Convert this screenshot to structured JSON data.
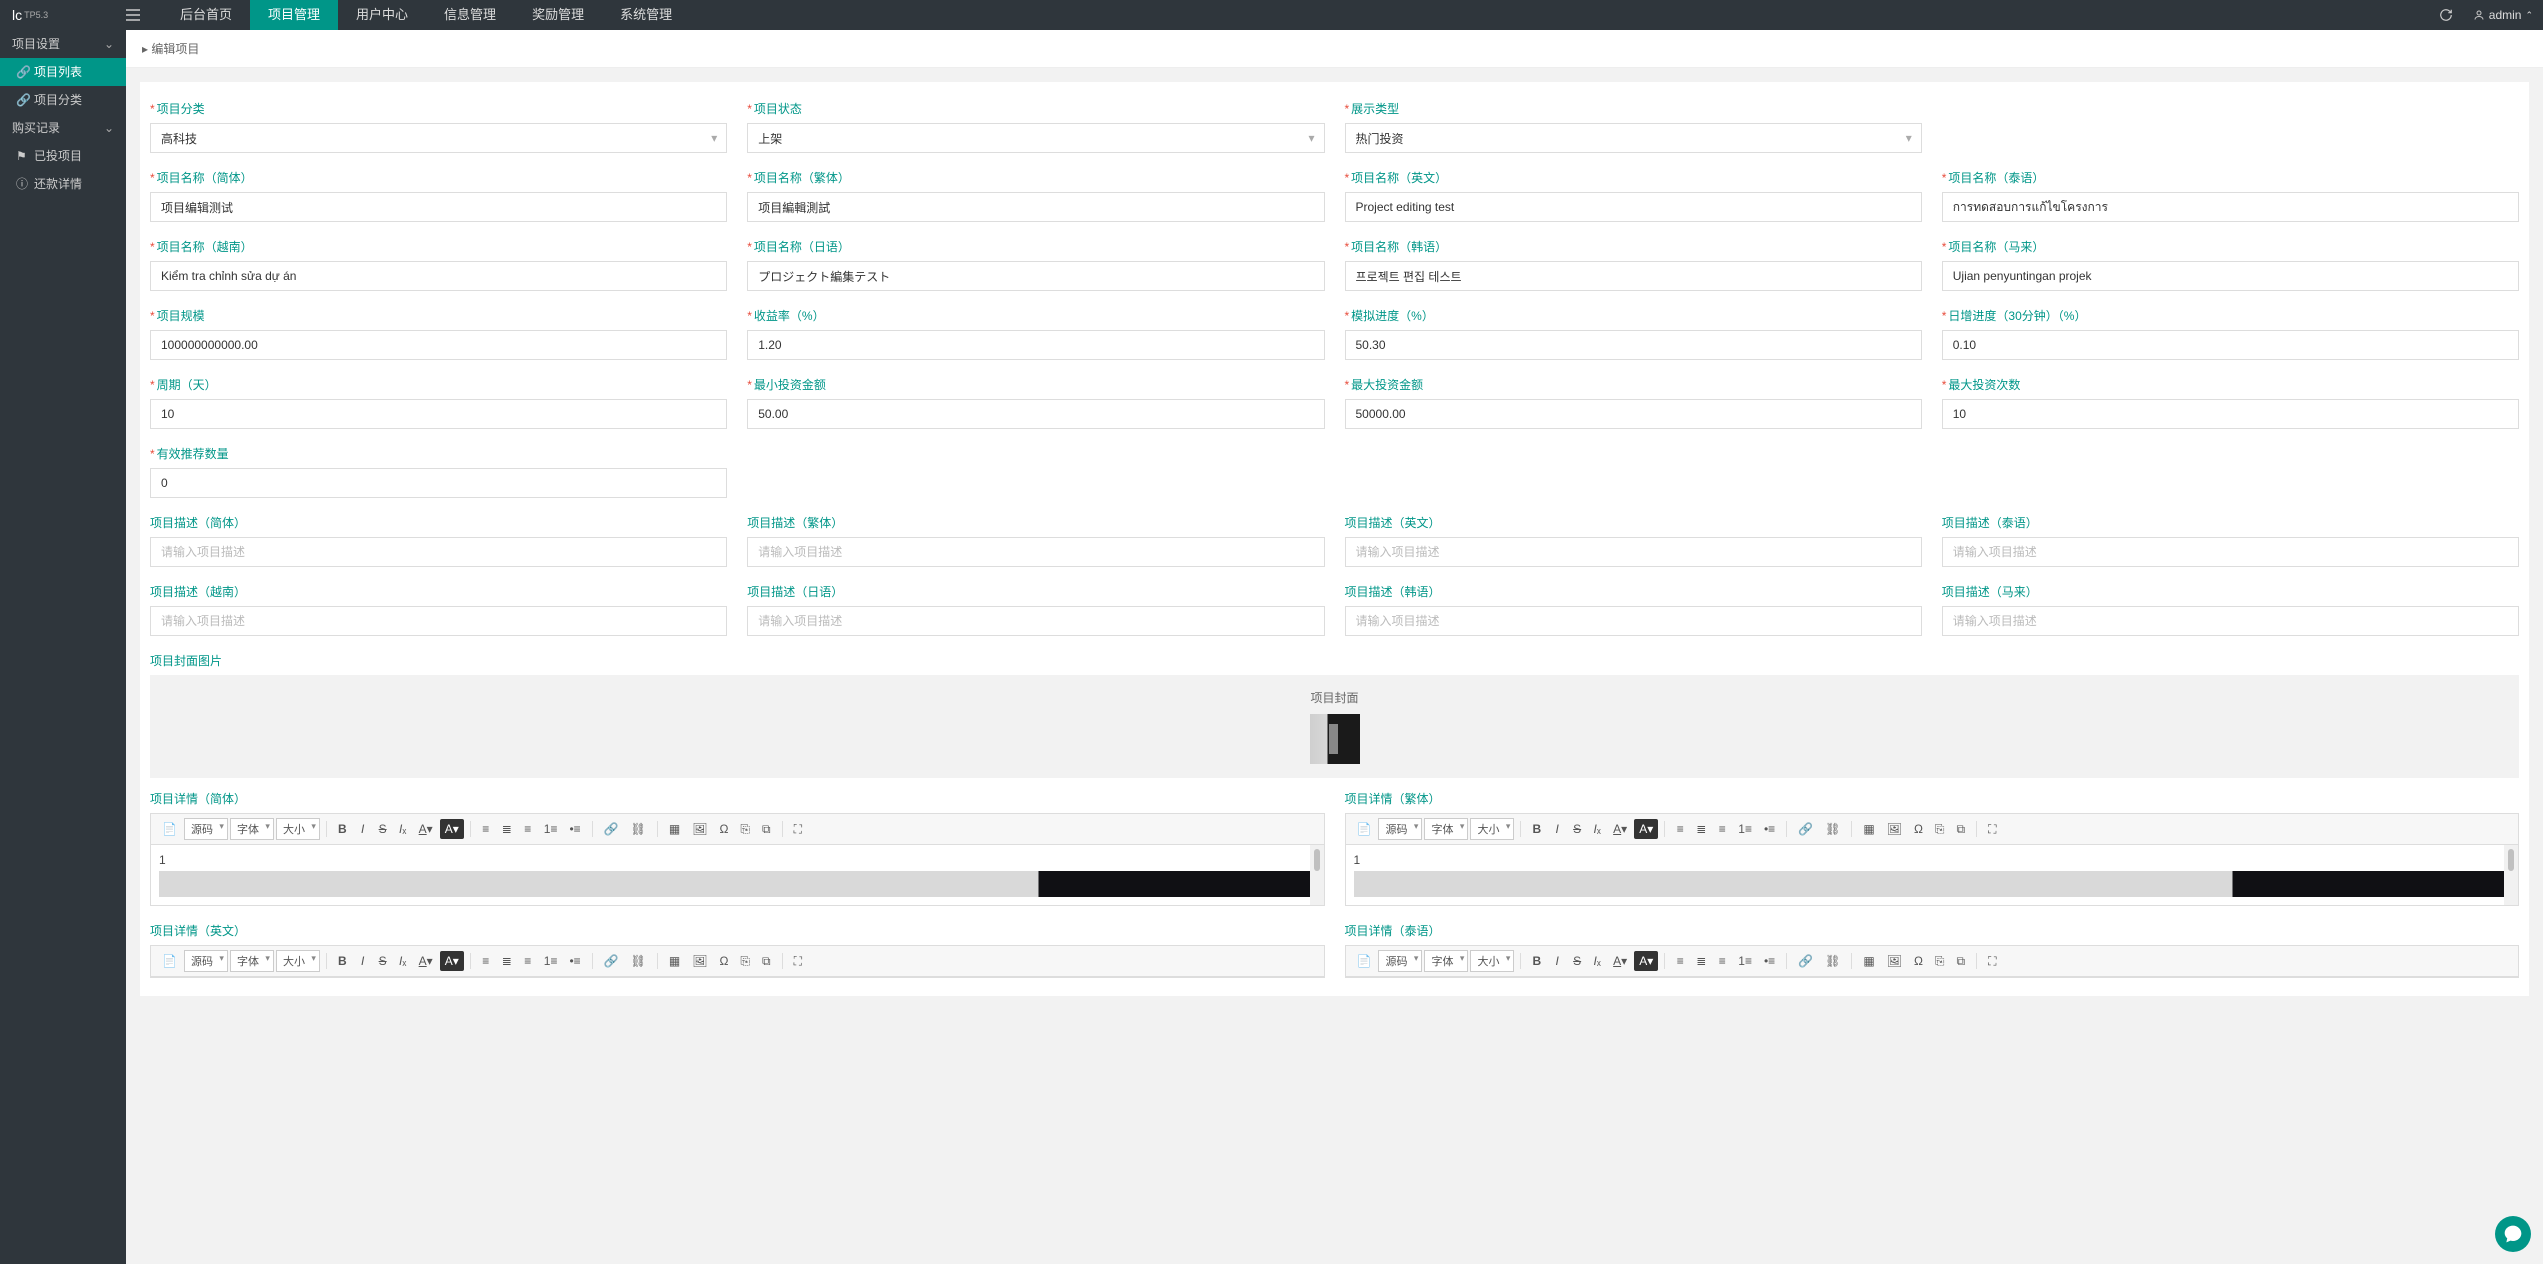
{
  "brand": {
    "name": "lc",
    "sup": "TP5.3"
  },
  "nav": {
    "items": [
      "后台首页",
      "项目管理",
      "用户中心",
      "信息管理",
      "奖励管理",
      "系统管理"
    ],
    "active_index": 1
  },
  "user": {
    "name": "admin"
  },
  "sidebar": {
    "group1": {
      "title": "项目设置"
    },
    "items1": [
      {
        "label": "项目列表",
        "active": true
      },
      {
        "label": "项目分类",
        "active": false
      }
    ],
    "group2": {
      "title": "购买记录"
    },
    "items2": [
      {
        "label": "已投项目"
      },
      {
        "label": "还款详情"
      }
    ]
  },
  "breadcrumb": "编辑项目",
  "form": {
    "category": {
      "label": "项目分类",
      "value": "高科技"
    },
    "status": {
      "label": "项目状态",
      "value": "上架"
    },
    "display_type": {
      "label": "展示类型",
      "value": "热门投资"
    },
    "name_cn": {
      "label": "项目名称（简体）",
      "value": "项目编辑测试"
    },
    "name_tw": {
      "label": "项目名称（繁体）",
      "value": "项目編輯測試"
    },
    "name_en": {
      "label": "项目名称（英文）",
      "value": "Project editing test"
    },
    "name_th": {
      "label": "项目名称（泰语）",
      "value": "การทดสอบการแก้ไขโครงการ"
    },
    "name_vi": {
      "label": "项目名称（越南）",
      "value": "Kiểm tra chỉnh sửa dự án"
    },
    "name_ja": {
      "label": "项目名称（日语）",
      "value": "プロジェクト編集テスト"
    },
    "name_ko": {
      "label": "项目名称（韩语）",
      "value": "프로젝트 편집 테스트"
    },
    "name_ms": {
      "label": "项目名称（马来）",
      "value": "Ujian penyuntingan projek"
    },
    "scale": {
      "label": "项目规模",
      "value": "100000000000.00"
    },
    "yield": {
      "label": "收益率（%）",
      "value": "1.20"
    },
    "sim_progress": {
      "label": "模拟进度（%）",
      "value": "50.30"
    },
    "inc_progress": {
      "label": "日增进度（30分钟）（%）",
      "value": "0.10"
    },
    "period": {
      "label": "周期（天）",
      "value": "10"
    },
    "min_invest": {
      "label": "最小投资金额",
      "value": "50.00"
    },
    "max_invest": {
      "label": "最大投资金额",
      "value": "50000.00"
    },
    "max_times": {
      "label": "最大投资次数",
      "value": "10"
    },
    "rec_count": {
      "label": "有效推荐数量",
      "value": "0"
    },
    "desc_cn": {
      "label": "项目描述（简体）",
      "placeholder": "请输入项目描述"
    },
    "desc_tw": {
      "label": "项目描述（繁体）",
      "placeholder": "请输入项目描述"
    },
    "desc_en": {
      "label": "项目描述（英文）",
      "placeholder": "请输入项目描述"
    },
    "desc_th": {
      "label": "项目描述（泰语）",
      "placeholder": "请输入项目描述"
    },
    "desc_vi": {
      "label": "项目描述（越南）",
      "placeholder": "请输入项目描述"
    },
    "desc_ja": {
      "label": "项目描述（日语）",
      "placeholder": "请输入项目描述"
    },
    "desc_ko": {
      "label": "项目描述（韩语）",
      "placeholder": "请输入项目描述"
    },
    "desc_ms": {
      "label": "项目描述（马来）",
      "placeholder": "请输入项目描述"
    },
    "cover": {
      "label": "项目封面图片",
      "upload_label": "项目封面"
    },
    "detail_cn": {
      "label": "项目详情（简体）",
      "content": "1"
    },
    "detail_tw": {
      "label": "项目详情（繁体）",
      "content": "1"
    },
    "detail_en": {
      "label": "项目详情（英文）"
    },
    "detail_th": {
      "label": "项目详情（泰语）"
    }
  },
  "editor_toolbar": {
    "source": "源码",
    "font": "字体",
    "size": "大小"
  }
}
